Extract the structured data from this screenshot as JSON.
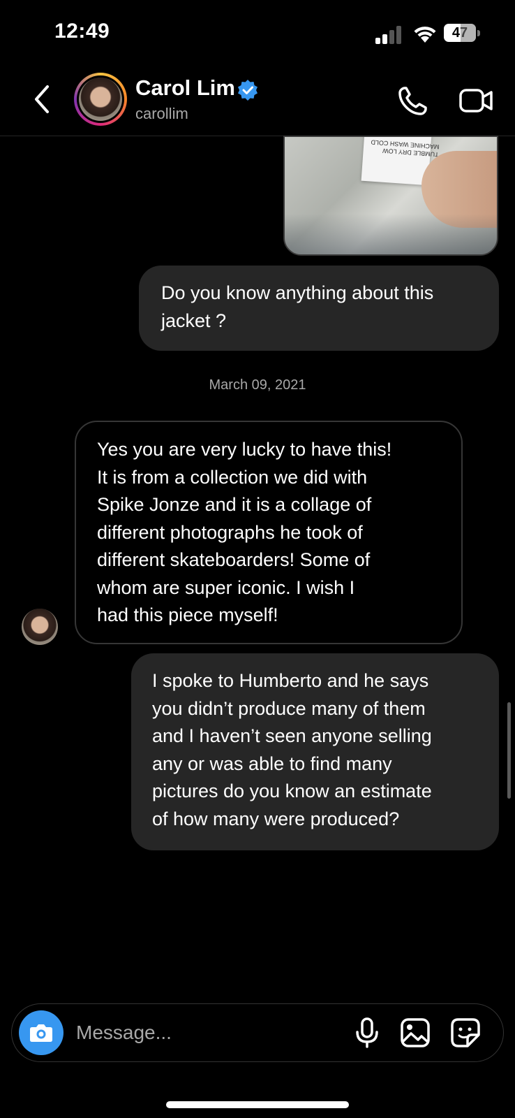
{
  "status_bar": {
    "time": "12:49",
    "battery": "47",
    "icons": [
      "cellular-signal-icon",
      "wifi-icon",
      "battery-icon"
    ]
  },
  "header": {
    "contact_name": "Carol Lim",
    "contact_handle": "carollim",
    "verified": true,
    "icons": [
      "back-chevron-icon",
      "verified-badge-icon",
      "phone-icon",
      "video-camera-icon"
    ]
  },
  "conversation": {
    "shared_image_tag_lines": [
      "TUMBLE DRY LOW",
      "MACHINE WASH COLD"
    ],
    "messages": [
      {
        "sender": "me",
        "lines": [
          "Do you know anything about this",
          "jacket ?"
        ]
      },
      {
        "sender": "carollim",
        "lines": [
          "Yes you are very lucky to have this!",
          "It is from a collection we did with",
          "Spike Jonze and it is a collage of",
          "different photographs he took of",
          "different skateboarders!  Some of",
          "whom are super iconic.  I wish I",
          "had this piece myself!"
        ]
      },
      {
        "sender": "me",
        "lines": [
          "I spoke to Humberto and he says",
          "you didn’t produce many of them",
          "and I haven’t seen anyone selling",
          "any or was able to find many",
          "pictures do you know an estimate",
          "of how many were produced?"
        ]
      }
    ],
    "date_separator": "March 09, 2021"
  },
  "composer": {
    "placeholder": "Message...",
    "icons": [
      "camera-icon",
      "microphone-icon",
      "gallery-icon",
      "sticker-icon"
    ]
  },
  "colors": {
    "background": "#000000",
    "sent_bubble": "#262626",
    "received_border": "#363636",
    "accent": "#3797f0",
    "secondary_text": "#a8a8a8"
  }
}
